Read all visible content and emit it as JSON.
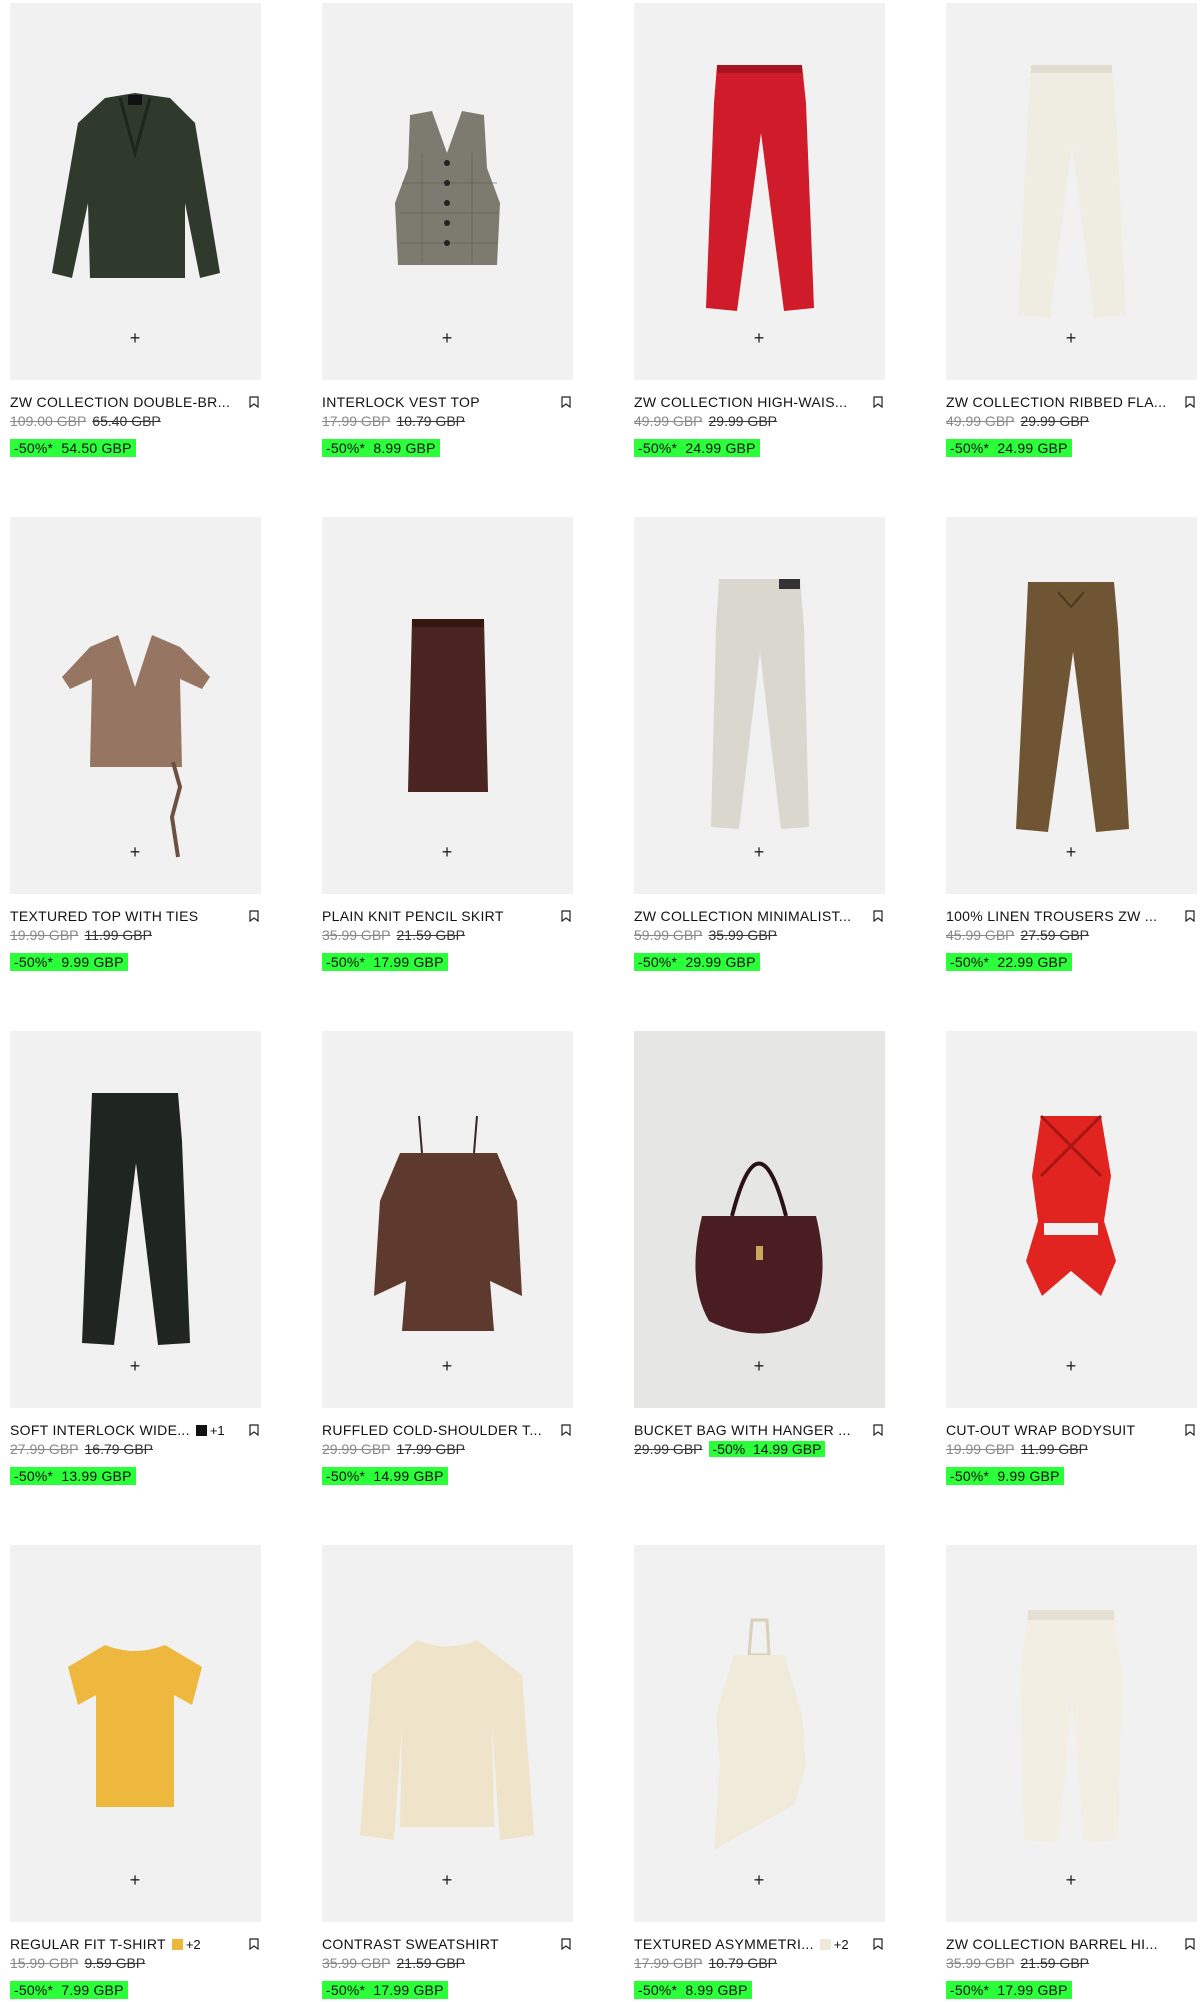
{
  "add_symbol": "+",
  "products": [
    {
      "name": "ZW COLLECTION DOUBLE-BR...",
      "old_price": "109.00 GBP",
      "prev_price": "65.40 GBP",
      "discount": "-50%*",
      "final_price": "54.50 GBP",
      "art": "blazer"
    },
    {
      "name": "INTERLOCK VEST TOP",
      "old_price": "17.99 GBP",
      "prev_price": "10.79 GBP",
      "discount": "-50%*",
      "final_price": "8.99 GBP",
      "art": "vest"
    },
    {
      "name": "ZW COLLECTION HIGH-WAIS...",
      "old_price": "49.99 GBP",
      "prev_price": "29.99 GBP",
      "discount": "-50%*",
      "final_price": "24.99 GBP",
      "art": "red-trousers"
    },
    {
      "name": "ZW COLLECTION RIBBED FLA...",
      "old_price": "49.99 GBP",
      "prev_price": "29.99 GBP",
      "discount": "-50%*",
      "final_price": "24.99 GBP",
      "art": "white-flare"
    },
    {
      "name": "TEXTURED TOP WITH TIES",
      "old_price": "19.99 GBP",
      "prev_price": "11.99 GBP",
      "discount": "-50%*",
      "final_price": "9.99 GBP",
      "art": "textured-top"
    },
    {
      "name": "PLAIN KNIT PENCIL SKIRT",
      "old_price": "35.99 GBP",
      "prev_price": "21.59 GBP",
      "discount": "-50%*",
      "final_price": "17.99 GBP",
      "art": "skirt"
    },
    {
      "name": "ZW COLLECTION MINIMALIST...",
      "old_price": "59.99 GBP",
      "prev_price": "35.99 GBP",
      "discount": "-50%*",
      "final_price": "29.99 GBP",
      "art": "grey-trousers"
    },
    {
      "name": "100% LINEN TROUSERS ZW ...",
      "old_price": "45.99 GBP",
      "prev_price": "27.59 GBP",
      "discount": "-50%*",
      "final_price": "22.99 GBP",
      "art": "linen-trousers"
    },
    {
      "name": "SOFT INTERLOCK WIDE...",
      "old_price": "27.99 GBP",
      "prev_price": "16.79 GBP",
      "discount": "-50%*",
      "final_price": "13.99 GBP",
      "art": "black-trousers",
      "swatch_color": "#111111",
      "swatch_more": "+1"
    },
    {
      "name": "RUFFLED COLD-SHOULDER T...",
      "old_price": "29.99 GBP",
      "prev_price": "17.99 GBP",
      "discount": "-50%*",
      "final_price": "14.99 GBP",
      "art": "ruffled-top"
    },
    {
      "name": "BUCKET BAG WITH HANGER ...",
      "old_price": "29.99 GBP",
      "discount": "-50%",
      "final_price": "14.99 GBP",
      "art": "bag",
      "inline": true
    },
    {
      "name": "CUT-OUT WRAP BODYSUIT",
      "old_price": "19.99 GBP",
      "prev_price": "11.99 GBP",
      "discount": "-50%*",
      "final_price": "9.99 GBP",
      "art": "bodysuit"
    },
    {
      "name": "REGULAR FIT T-SHIRT",
      "old_price": "15.99 GBP",
      "prev_price": "9.59 GBP",
      "discount": "-50%*",
      "final_price": "7.99 GBP",
      "art": "tshirt",
      "swatch_color": "#e8b93c",
      "swatch_more": "+2"
    },
    {
      "name": "CONTRAST SWEATSHIRT",
      "old_price": "35.99 GBP",
      "prev_price": "21.59 GBP",
      "discount": "-50%*",
      "final_price": "17.99 GBP",
      "art": "sweatshirt"
    },
    {
      "name": "TEXTURED ASYMMETRI...",
      "old_price": "17.99 GBP",
      "prev_price": "10.79 GBP",
      "discount": "-50%*",
      "final_price": "8.99 GBP",
      "art": "halter",
      "swatch_color": "#efe9dc",
      "swatch_more": "+2"
    },
    {
      "name": "ZW COLLECTION BARREL HI...",
      "old_price": "35.99 GBP",
      "prev_price": "21.59 GBP",
      "discount": "-50%*",
      "final_price": "17.99 GBP",
      "art": "barrel-jeans"
    }
  ]
}
